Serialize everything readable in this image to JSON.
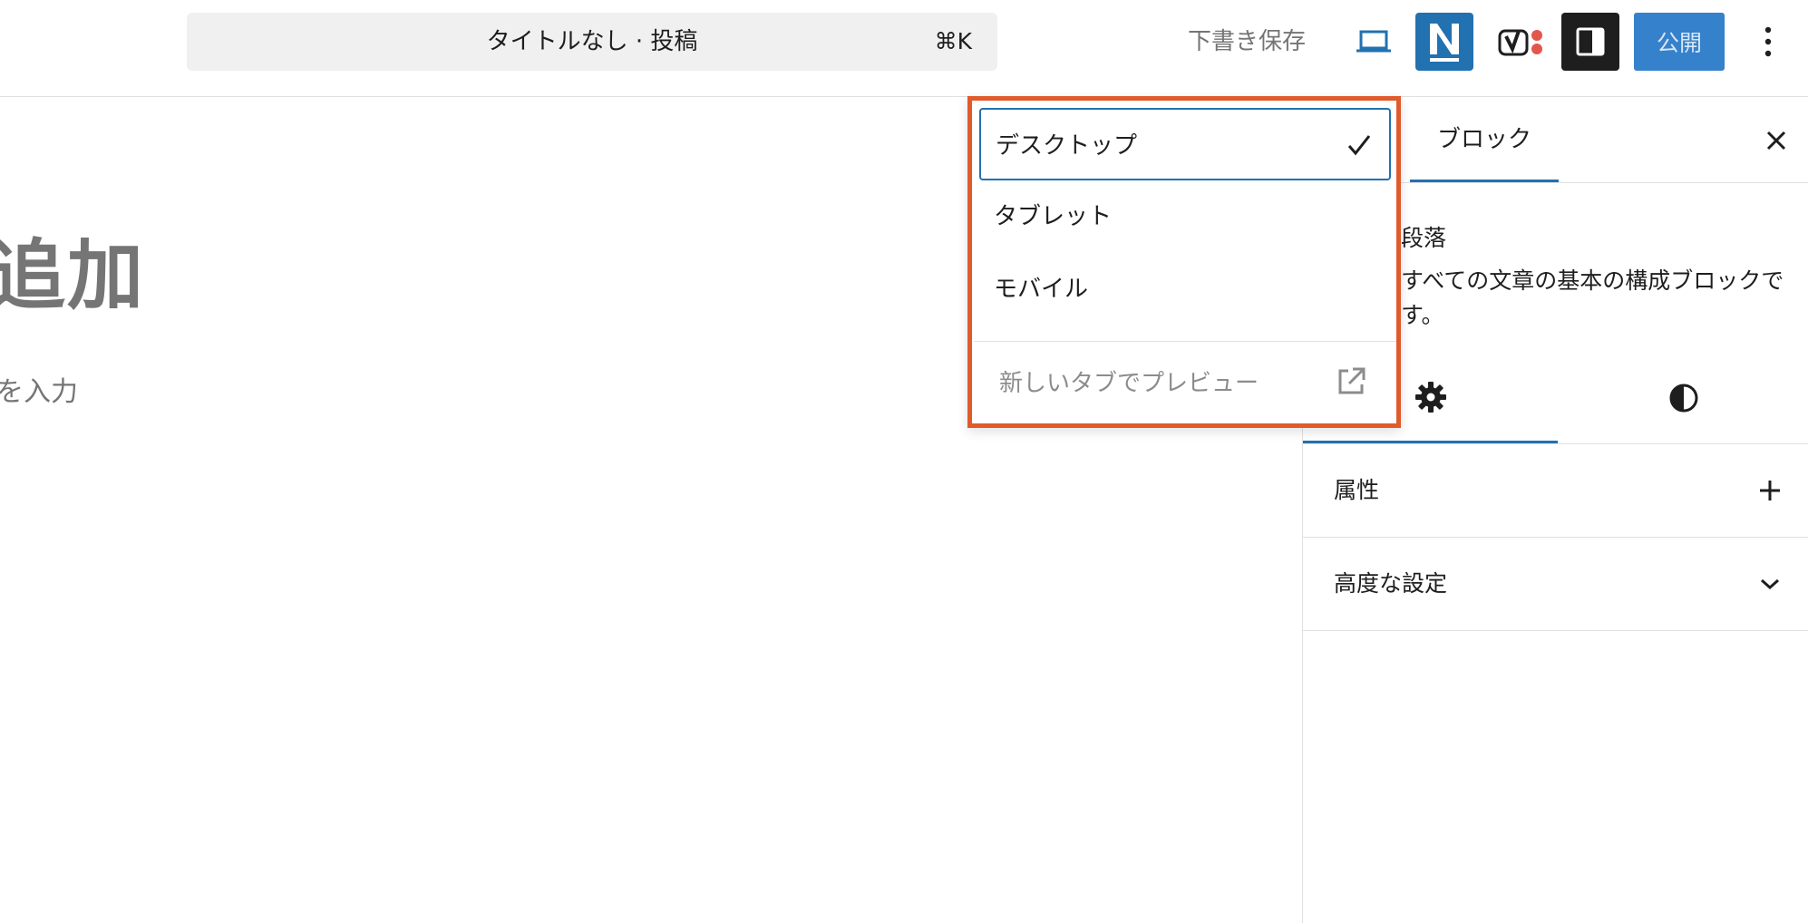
{
  "header": {
    "command_title": "タイトルなし · 投稿",
    "command_shortcut": "⌘K",
    "save_draft": "下書き保存",
    "publish": "公開",
    "icons": [
      "laptop-icon",
      "n-plugin-icon",
      "yoast-icon",
      "sidebar-toggle-icon",
      "more-vertical-icon"
    ],
    "colors": {
      "publish_bg": "#3581cc",
      "plugin_bg": "#2271b1",
      "toggle_bg": "#1e1e1e",
      "yoast_dot": "#e2574c"
    }
  },
  "editor": {
    "title_fragment": "追加",
    "body_fragment": "を入力"
  },
  "sidebar": {
    "tab_block": "ブロック",
    "block_name": "段落",
    "block_description": "すべての文章の基本の構成ブロックです。",
    "panels": [
      {
        "label": "属性",
        "icon": "plus-icon"
      },
      {
        "label": "高度な設定",
        "icon": "chevron-down-icon"
      }
    ]
  },
  "device_menu": {
    "items": [
      {
        "label": "デスクトップ",
        "selected": true
      },
      {
        "label": "タブレット",
        "selected": false
      },
      {
        "label": "モバイル",
        "selected": false
      }
    ],
    "preview_new_tab": "新しいタブでプレビュー",
    "highlight_color": "#e05a2b",
    "accent_color": "#2271b1"
  }
}
